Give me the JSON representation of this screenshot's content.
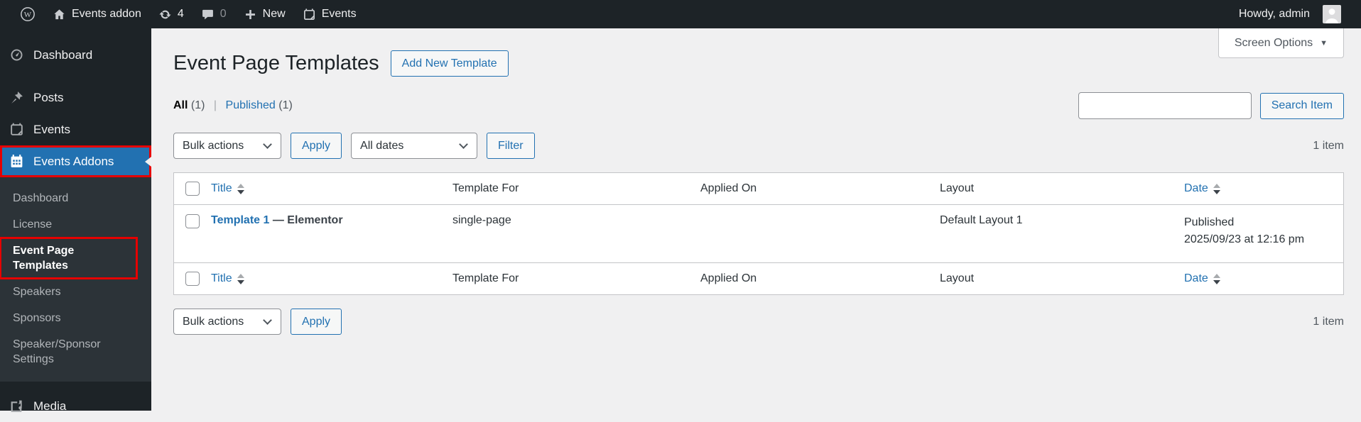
{
  "colors": {
    "accent": "#2271b1",
    "annotation_red": "#e60000",
    "bar_bg": "#1d2327",
    "content_bg": "#f0f0f1"
  },
  "admin_bar": {
    "site_name": "Events addon",
    "updates_count": "4",
    "comments_count": "0",
    "new_label": "New",
    "events_label": "Events",
    "howdy": "Howdy, admin"
  },
  "sidebar": {
    "dashboard": "Dashboard",
    "posts": "Posts",
    "events": "Events",
    "events_addons": "Events Addons",
    "media": "Media",
    "submenu": {
      "dashboard": "Dashboard",
      "license": "License",
      "event_page_templates": "Event Page Templates",
      "speakers": "Speakers",
      "sponsors": "Sponsors",
      "speaker_sponsor_settings": "Speaker/Sponsor Settings"
    }
  },
  "header": {
    "title": "Event Page Templates",
    "add_new_button": "Add New Template",
    "screen_options": "Screen Options"
  },
  "list": {
    "filter_all": "All",
    "filter_all_count": "(1)",
    "filter_published": "Published",
    "filter_published_count": "(1)",
    "search_button": "Search Item",
    "items_count": "1 item"
  },
  "nav": {
    "bulk_actions": "Bulk actions",
    "apply": "Apply",
    "all_dates": "All dates",
    "filter": "Filter"
  },
  "table": {
    "headers": {
      "title": "Title",
      "template_for": "Template For",
      "applied_on": "Applied On",
      "layout": "Layout",
      "date": "Date"
    },
    "row": {
      "title": "Template 1",
      "post_state": "— Elementor",
      "template_for": "single-page",
      "applied_on": "",
      "layout": "Default Layout 1",
      "date_status": "Published",
      "date_value": "2025/09/23 at 12:16 pm"
    }
  }
}
